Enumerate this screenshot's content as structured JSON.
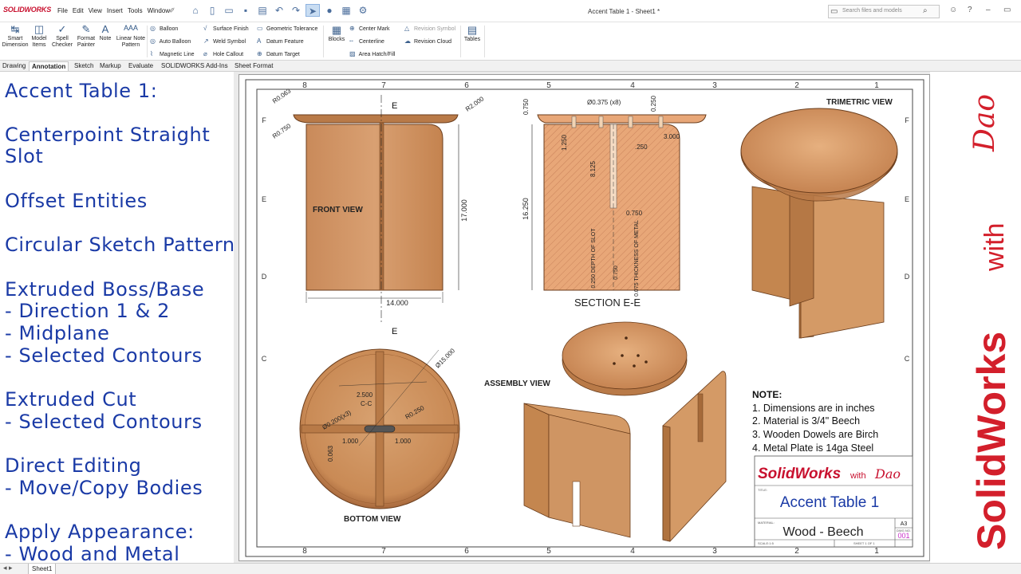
{
  "app": {
    "logo": "SOLIDWORKS",
    "menu": [
      "File",
      "Edit",
      "View",
      "Insert",
      "Tools",
      "Window"
    ],
    "doc_title": "Accent Table 1 - Sheet1 *",
    "search_placeholder": "Search files and models"
  },
  "ribbon": {
    "big": [
      "Smart\nDimension",
      "Model\nItems",
      "Spell\nChecker",
      "Format\nPainter",
      "Note",
      "Linear Note\nPattern"
    ],
    "col1": [
      "Balloon",
      "Auto Balloon",
      "Magnetic Line"
    ],
    "col2": [
      "Surface Finish",
      "Weld Symbol",
      "Hole Callout"
    ],
    "col3": [
      "Geometric Tolerance",
      "Datum Feature",
      "Datum Target"
    ],
    "blocks": "Blocks",
    "col4": [
      "Center Mark",
      "Centerline",
      "Area Hatch/Fill"
    ],
    "col5": [
      "Revision Symbol",
      "Revision Cloud"
    ],
    "tables": "Tables"
  },
  "tabs": [
    "Drawing",
    "Annotation",
    "Sketch",
    "Markup",
    "Evaluate",
    "SOLIDWORKS Add-Ins",
    "Sheet Format"
  ],
  "active_tab": "Annotation",
  "left_panel": {
    "lines": [
      "Accent Table 1:",
      "Centerpoint Straight",
      "Slot",
      "Offset Entities",
      "Circular Sketch Pattern",
      "Extruded Boss/Base",
      "- Direction 1 & 2",
      "- Midplane",
      "- Selected Contours",
      "Extruded Cut",
      "- Selected Contours",
      "Direct Editing",
      "- Move/Copy Bodies",
      "Apply Appearance:",
      "- Wood and Metal"
    ]
  },
  "drawing": {
    "zone_cols": [
      "8",
      "7",
      "6",
      "5",
      "4",
      "3",
      "2",
      "1"
    ],
    "zone_rows": [
      "F",
      "E",
      "D",
      "C"
    ],
    "views": {
      "front": "FRONT VIEW",
      "section": "SECTION E-E",
      "trimetric": "TRIMETRIC VIEW",
      "bottom": "BOTTOM VIEW",
      "assembly": "ASSEMBLY VIEW"
    },
    "section_marker": "E",
    "dims_front": {
      "r_top": "R0.063",
      "r_side": "R0.750",
      "r_big": "R2.000",
      "height": "17.000",
      "width": "14.000"
    },
    "dims_section": {
      "t750": "0.750",
      "dowel": "Ø0.375 (x8)",
      "t250": "0.250",
      "d1250": "1.250",
      "d3000": "3.000",
      "d8125": "8.125",
      "d250b": ".250",
      "d16250": "16.250",
      "d0750b": "0.750",
      "depth": "0.250 DEPTH\nOF SLOT",
      "d0750c": "0.750",
      "thick": "0.075 THICKNESS\nOF METAL"
    },
    "dims_bottom": {
      "dia": "Ø15.000",
      "slot": "2.500",
      "cc": "C-C",
      "holes": "Ø0.200(x3)",
      "r250": "R0.250",
      "d1000a": "1.000",
      "d1000b": "1.000",
      "d063": "0.063"
    },
    "notes": {
      "title": "NOTE:",
      "items": [
        "1. Dimensions are in inches",
        "2. Material is 3/4\" Beech",
        "3. Wooden Dowels are Birch",
        "4. Metal Plate is 14ga Steel"
      ]
    },
    "title_block": {
      "brand": "SolidWorks",
      "brand_with": "with",
      "brand_sig": "Dao",
      "title_label": "TITLE:",
      "title": "Accent Table 1",
      "material_label": "MATERIAL:",
      "material": "Wood - Beech",
      "size": "A3",
      "dwg_label": "DWG NO.",
      "dwg": "001",
      "scale": "SCALE:1:5",
      "sheet": "SHEET 1 OF 1"
    }
  },
  "right_panel": {
    "brand": "SolidWorks",
    "with": "with",
    "sig": "Dao"
  },
  "status": {
    "sheet_tab": "Sheet1"
  }
}
